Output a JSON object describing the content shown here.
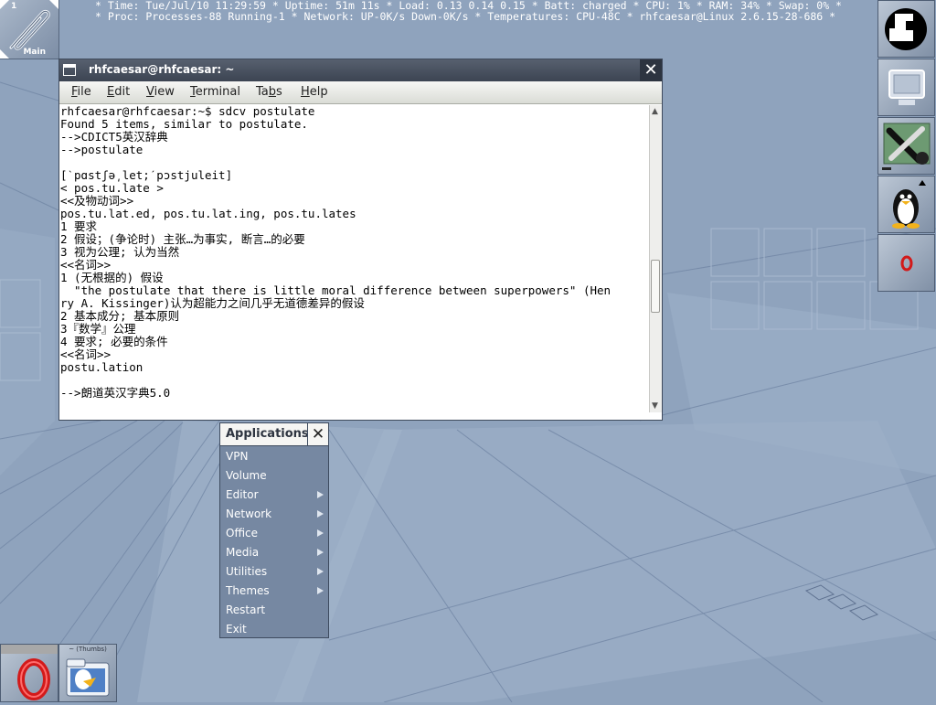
{
  "status_bar": {
    "line1": "* Time: Tue/Jul/10 11:29:59 * Uptime: 51m 11s * Load: 0.13 0.14 0.15 * Batt: charged * CPU: 1% * RAM: 34% * Swap: 0% *",
    "line2": "* Proc: Processes-88 Running-1 * Network: UP-0K/s Down-0K/s * Temperatures: CPU-48C * rhfcaesar@Linux 2.6.15-28-686 *"
  },
  "pager": {
    "workspace_number": "1",
    "workspace_name": "Main"
  },
  "dock": {
    "icons": [
      "wm-logo-icon",
      "monitor-icon",
      "settings-tools-icon",
      "tux-penguin-icon",
      "opera-icon"
    ]
  },
  "terminal": {
    "title": "rhfcaesar@rhfcaesar: ~",
    "close_label": "✕",
    "menu": [
      {
        "label": "File",
        "key": "F",
        "rest": "ile"
      },
      {
        "label": "Edit",
        "key": "E",
        "rest": "dit"
      },
      {
        "label": "View",
        "key": "V",
        "rest": "iew"
      },
      {
        "label": "Terminal",
        "key": "T",
        "rest": "erminal"
      },
      {
        "label": "Tabs",
        "key": "b",
        "pre": "Ta",
        "rest": "s"
      },
      {
        "label": "Help",
        "key": "H",
        "rest": "elp"
      }
    ],
    "lines": [
      "rhfcaesar@rhfcaesar:~$ sdcv postulate",
      "Found 5 items, similar to postulate.",
      "-->CDICT5英汉辞典",
      "-->postulate",
      "",
      "[ˋpɑstʃə͵let;ˊpɔstjuleit]",
      "< pos.tu.late >",
      "<<及物动词>>",
      "pos.tu.lat.ed, pos.tu.lat.ing, pos.tu.lates",
      "1 要求",
      "2 假设；(争论时) 主张…为事实, 断言…的必要",
      "3 视为公理; 认为当然",
      "<<名词>>",
      "1 (无根据的) 假设",
      "  \"the postulate that there is little moral difference between superpowers\" (Hen",
      "ry A. Kissinger)认为超能力之间几乎无道德差异的假设",
      "2 基本成分; 基本原则",
      "3『数学』公理",
      "4 要求; 必要的条件",
      "<<名词>>",
      "postu.lation",
      "",
      "-->朗道英汉字典5.0"
    ]
  },
  "applications_menu": {
    "title": "Applications",
    "close_label": "✕",
    "items": [
      {
        "label": "VPN",
        "submenu": false
      },
      {
        "label": "Volume",
        "submenu": false
      },
      {
        "label": "Editor",
        "submenu": true
      },
      {
        "label": "Network",
        "submenu": true
      },
      {
        "label": "Office",
        "submenu": true
      },
      {
        "label": "Media",
        "submenu": true
      },
      {
        "label": "Utilities",
        "submenu": true
      },
      {
        "label": "Themes",
        "submenu": true
      },
      {
        "label": "Restart",
        "submenu": false
      },
      {
        "label": "Exit",
        "submenu": false
      }
    ]
  },
  "taskbar": {
    "thumbs_label": "~ (Thumbs)"
  }
}
